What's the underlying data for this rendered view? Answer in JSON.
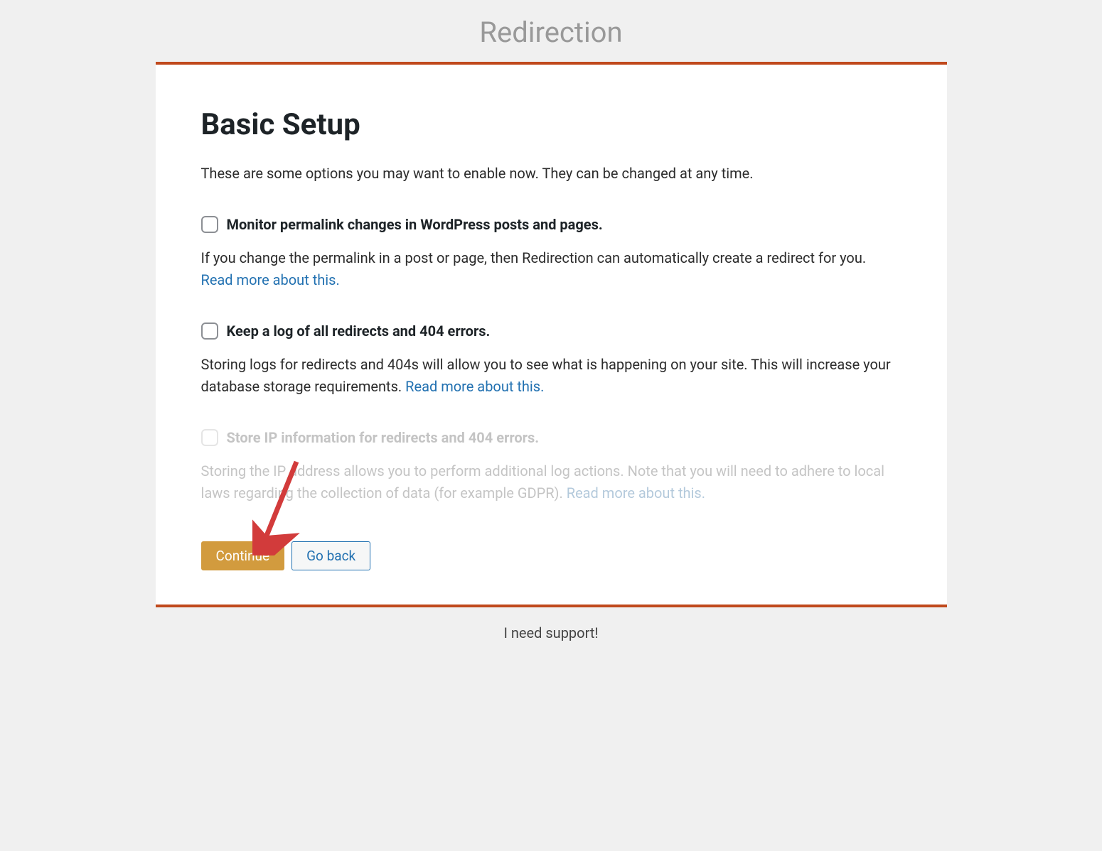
{
  "header": {
    "title": "Redirection"
  },
  "main": {
    "section_title": "Basic Setup",
    "intro": "These are some options you may want to enable now. They can be changed at any time.",
    "options": [
      {
        "label": "Monitor permalink changes in WordPress posts and pages.",
        "desc_prefix": "If you change the permalink in a post or page, then Redirection can automatically create a redirect for you. ",
        "link_text": "Read more about this.",
        "disabled": false
      },
      {
        "label": "Keep a log of all redirects and 404 errors.",
        "desc_prefix": "Storing logs for redirects and 404s will allow you to see what is happening on your site. This will increase your database storage requirements. ",
        "link_text": "Read more about this.",
        "disabled": false
      },
      {
        "label": "Store IP information for redirects and 404 errors.",
        "desc_prefix": "Storing the IP address allows you to perform additional log actions. Note that you will need to adhere to local laws regarding the collection of data (for example GDPR). ",
        "link_text": "Read more about this.",
        "disabled": true
      }
    ],
    "buttons": {
      "continue": "Continue",
      "go_back": "Go back"
    }
  },
  "footer": {
    "support": "I need support!"
  }
}
